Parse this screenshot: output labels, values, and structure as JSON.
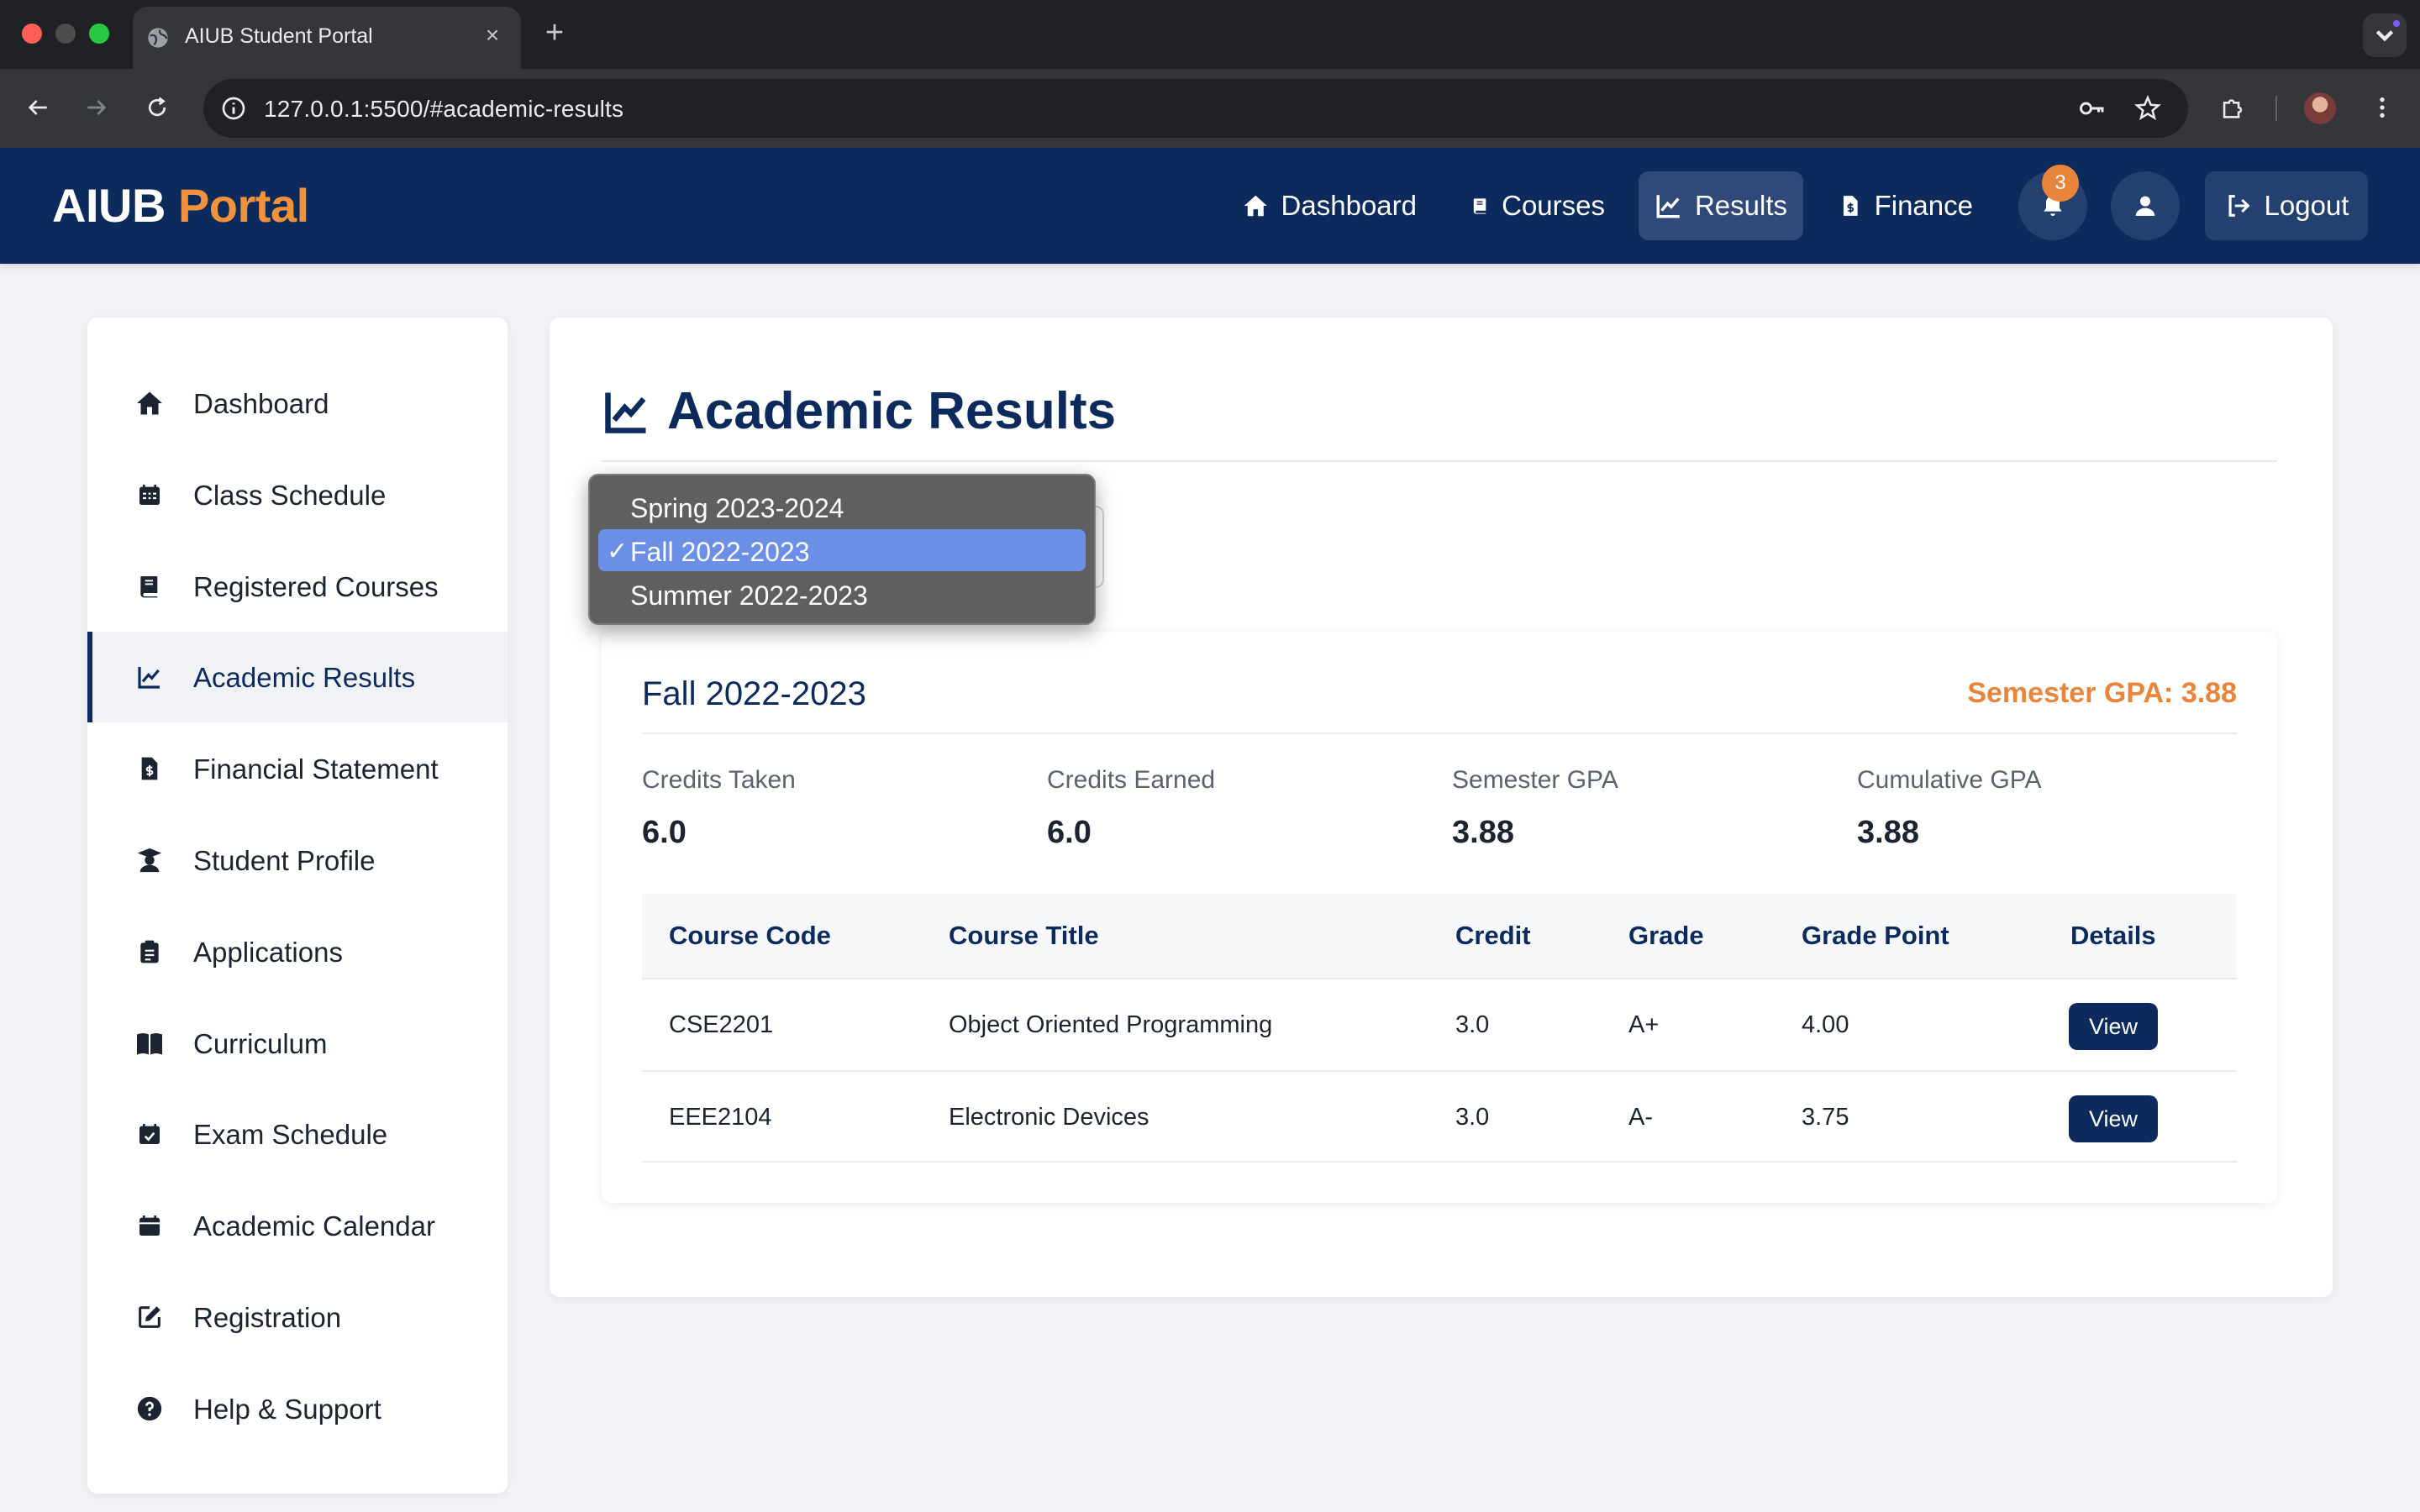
{
  "browser": {
    "tab_title": "AIUB Student Portal",
    "new_tab_symbol": "+",
    "close_symbol": "×",
    "url": "127.0.0.1:5500/#academic-results"
  },
  "header": {
    "brand_main": "AIUB",
    "brand_accent": "Portal",
    "nav": [
      {
        "label": "Dashboard",
        "icon": "home-icon"
      },
      {
        "label": "Courses",
        "icon": "book-icon"
      },
      {
        "label": "Results",
        "icon": "chart-line-icon",
        "active": true
      },
      {
        "label": "Finance",
        "icon": "invoice-icon"
      }
    ],
    "notification_count": "3",
    "logout_label": "Logout"
  },
  "sidebar": {
    "items": [
      {
        "label": "Dashboard",
        "icon": "home-icon"
      },
      {
        "label": "Class Schedule",
        "icon": "calendar-grid-icon"
      },
      {
        "label": "Registered Courses",
        "icon": "book-icon"
      },
      {
        "label": "Academic Results",
        "icon": "chart-line-icon",
        "active": true
      },
      {
        "label": "Financial Statement",
        "icon": "invoice-icon"
      },
      {
        "label": "Student Profile",
        "icon": "graduate-icon"
      },
      {
        "label": "Applications",
        "icon": "clipboard-icon"
      },
      {
        "label": "Curriculum",
        "icon": "open-book-icon"
      },
      {
        "label": "Exam Schedule",
        "icon": "calendar-check-icon"
      },
      {
        "label": "Academic Calendar",
        "icon": "calendar-icon"
      },
      {
        "label": "Registration",
        "icon": "edit-icon"
      },
      {
        "label": "Help & Support",
        "icon": "question-circle-icon"
      }
    ]
  },
  "main": {
    "title": "Academic Results",
    "semester_select": {
      "options": [
        "Spring 2023-2024",
        "Fall 2022-2023",
        "Summer 2022-2023"
      ],
      "selected": "Fall 2022-2023",
      "check_mark": "✓"
    },
    "semester_card": {
      "title": "Fall 2022-2023",
      "gpa_text": "Semester GPA: 3.88",
      "stats": [
        {
          "label": "Credits Taken",
          "value": "6.0"
        },
        {
          "label": "Credits Earned",
          "value": "6.0"
        },
        {
          "label": "Semester GPA",
          "value": "3.88"
        },
        {
          "label": "Cumulative GPA",
          "value": "3.88"
        }
      ],
      "table": {
        "headers": [
          "Course Code",
          "Course Title",
          "Credit",
          "Grade",
          "Grade Point",
          "Details"
        ],
        "rows": [
          {
            "code": "CSE2201",
            "title": "Object Oriented Programming",
            "credit": "3.0",
            "grade": "A+",
            "grade_point": "4.00",
            "action": "View"
          },
          {
            "code": "EEE2104",
            "title": "Electronic Devices",
            "credit": "3.0",
            "grade": "A-",
            "grade_point": "3.75",
            "action": "View"
          }
        ]
      }
    }
  },
  "colors": {
    "primary": "#0d2a5c",
    "accent": "#e8853a",
    "selected_option": "#6b8fe6"
  }
}
